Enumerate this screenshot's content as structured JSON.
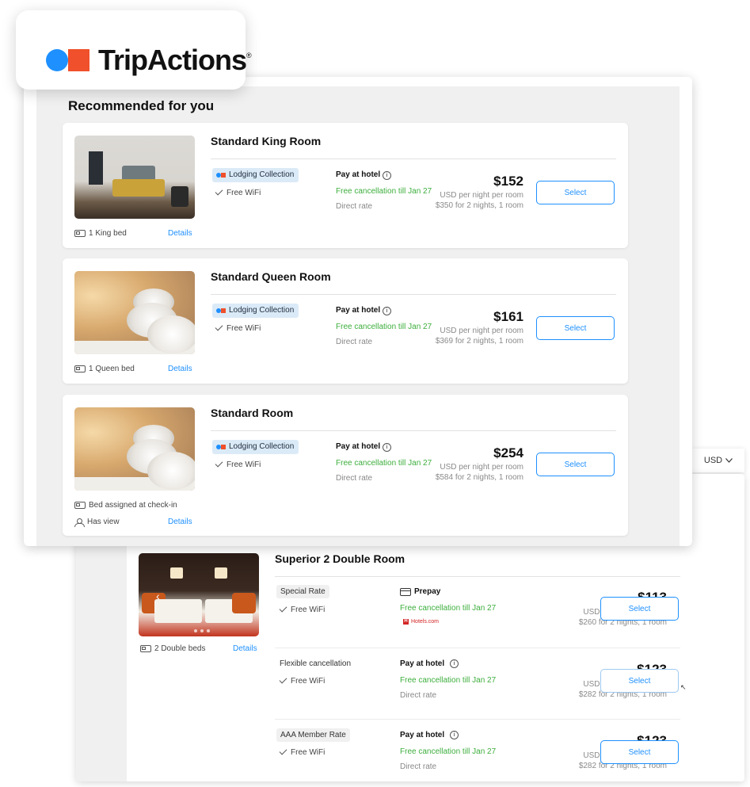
{
  "brand": {
    "name": "TripActions",
    "reg_mark": "®",
    "dot_color": "#1e90ff",
    "square_color": "#f0502b"
  },
  "section_title": "Recommended for you",
  "currency": {
    "label": "USD",
    "icon": "chevron-down-icon"
  },
  "front_rooms": [
    {
      "name": "Standard King Room",
      "badge": "Lodging Collection",
      "wifi": "Free WiFi",
      "payment": "Pay at hotel",
      "cancellation": "Free cancellation till Jan 27",
      "rate_type": "Direct rate",
      "price": "$152",
      "per_night": "USD per night per room",
      "total": "$350 for 2 nights, 1 room",
      "select": "Select",
      "bed": "1 King bed",
      "details": "Details"
    },
    {
      "name": "Standard Queen Room",
      "badge": "Lodging Collection",
      "wifi": "Free WiFi",
      "payment": "Pay at hotel",
      "cancellation": "Free cancellation till Jan 27",
      "rate_type": "Direct rate",
      "price": "$161",
      "per_night": "USD per night per room",
      "total": "$369 for 2 nights, 1 room",
      "select": "Select",
      "bed": "1 Queen bed",
      "details": "Details"
    },
    {
      "name": "Standard Room",
      "badge": "Lodging Collection",
      "wifi": "Free WiFi",
      "payment": "Pay at hotel",
      "cancellation": "Free cancellation till Jan 27",
      "rate_type": "Direct rate",
      "price": "$254",
      "per_night": "USD per night per room",
      "total": "$584 for 2 nights, 1 room",
      "select": "Select",
      "bed": "Bed assigned at check-in",
      "view": "Has view",
      "details": "Details"
    }
  ],
  "back_room": {
    "name": "Superior 2 Double Room",
    "bed": "2 Double beds",
    "details": "Details",
    "rates": [
      {
        "rate_name": "Special Rate",
        "wifi": "Free WiFi",
        "payment": "Prepay",
        "cancellation": "Free cancellation till Jan 27",
        "provider": "Hotels.com",
        "price": "$113",
        "per_night": "USD per night per room",
        "total": "$260 for 2 nights, 1 room",
        "select": "Select"
      },
      {
        "rate_name": "Flexible cancellation",
        "wifi": "Free WiFi",
        "payment": "Pay at hotel",
        "cancellation": "Free cancellation till Jan 27",
        "rate_type": "Direct rate",
        "price": "$123",
        "per_night": "USD per night per room",
        "total": "$282 for 2 nights, 1 room",
        "select": "Select"
      },
      {
        "rate_name": "AAA Member Rate",
        "wifi": "Free WiFi",
        "payment": "Pay at hotel",
        "cancellation": "Free cancellation till Jan 27",
        "rate_type": "Direct rate",
        "price": "$123",
        "per_night": "USD per night per room",
        "total": "$282 for 2 nights, 1 room",
        "select": "Select"
      }
    ]
  },
  "colors": {
    "accent": "#1e90ff",
    "success": "#3dae3d",
    "badge_bg": "#dbeaf7"
  }
}
